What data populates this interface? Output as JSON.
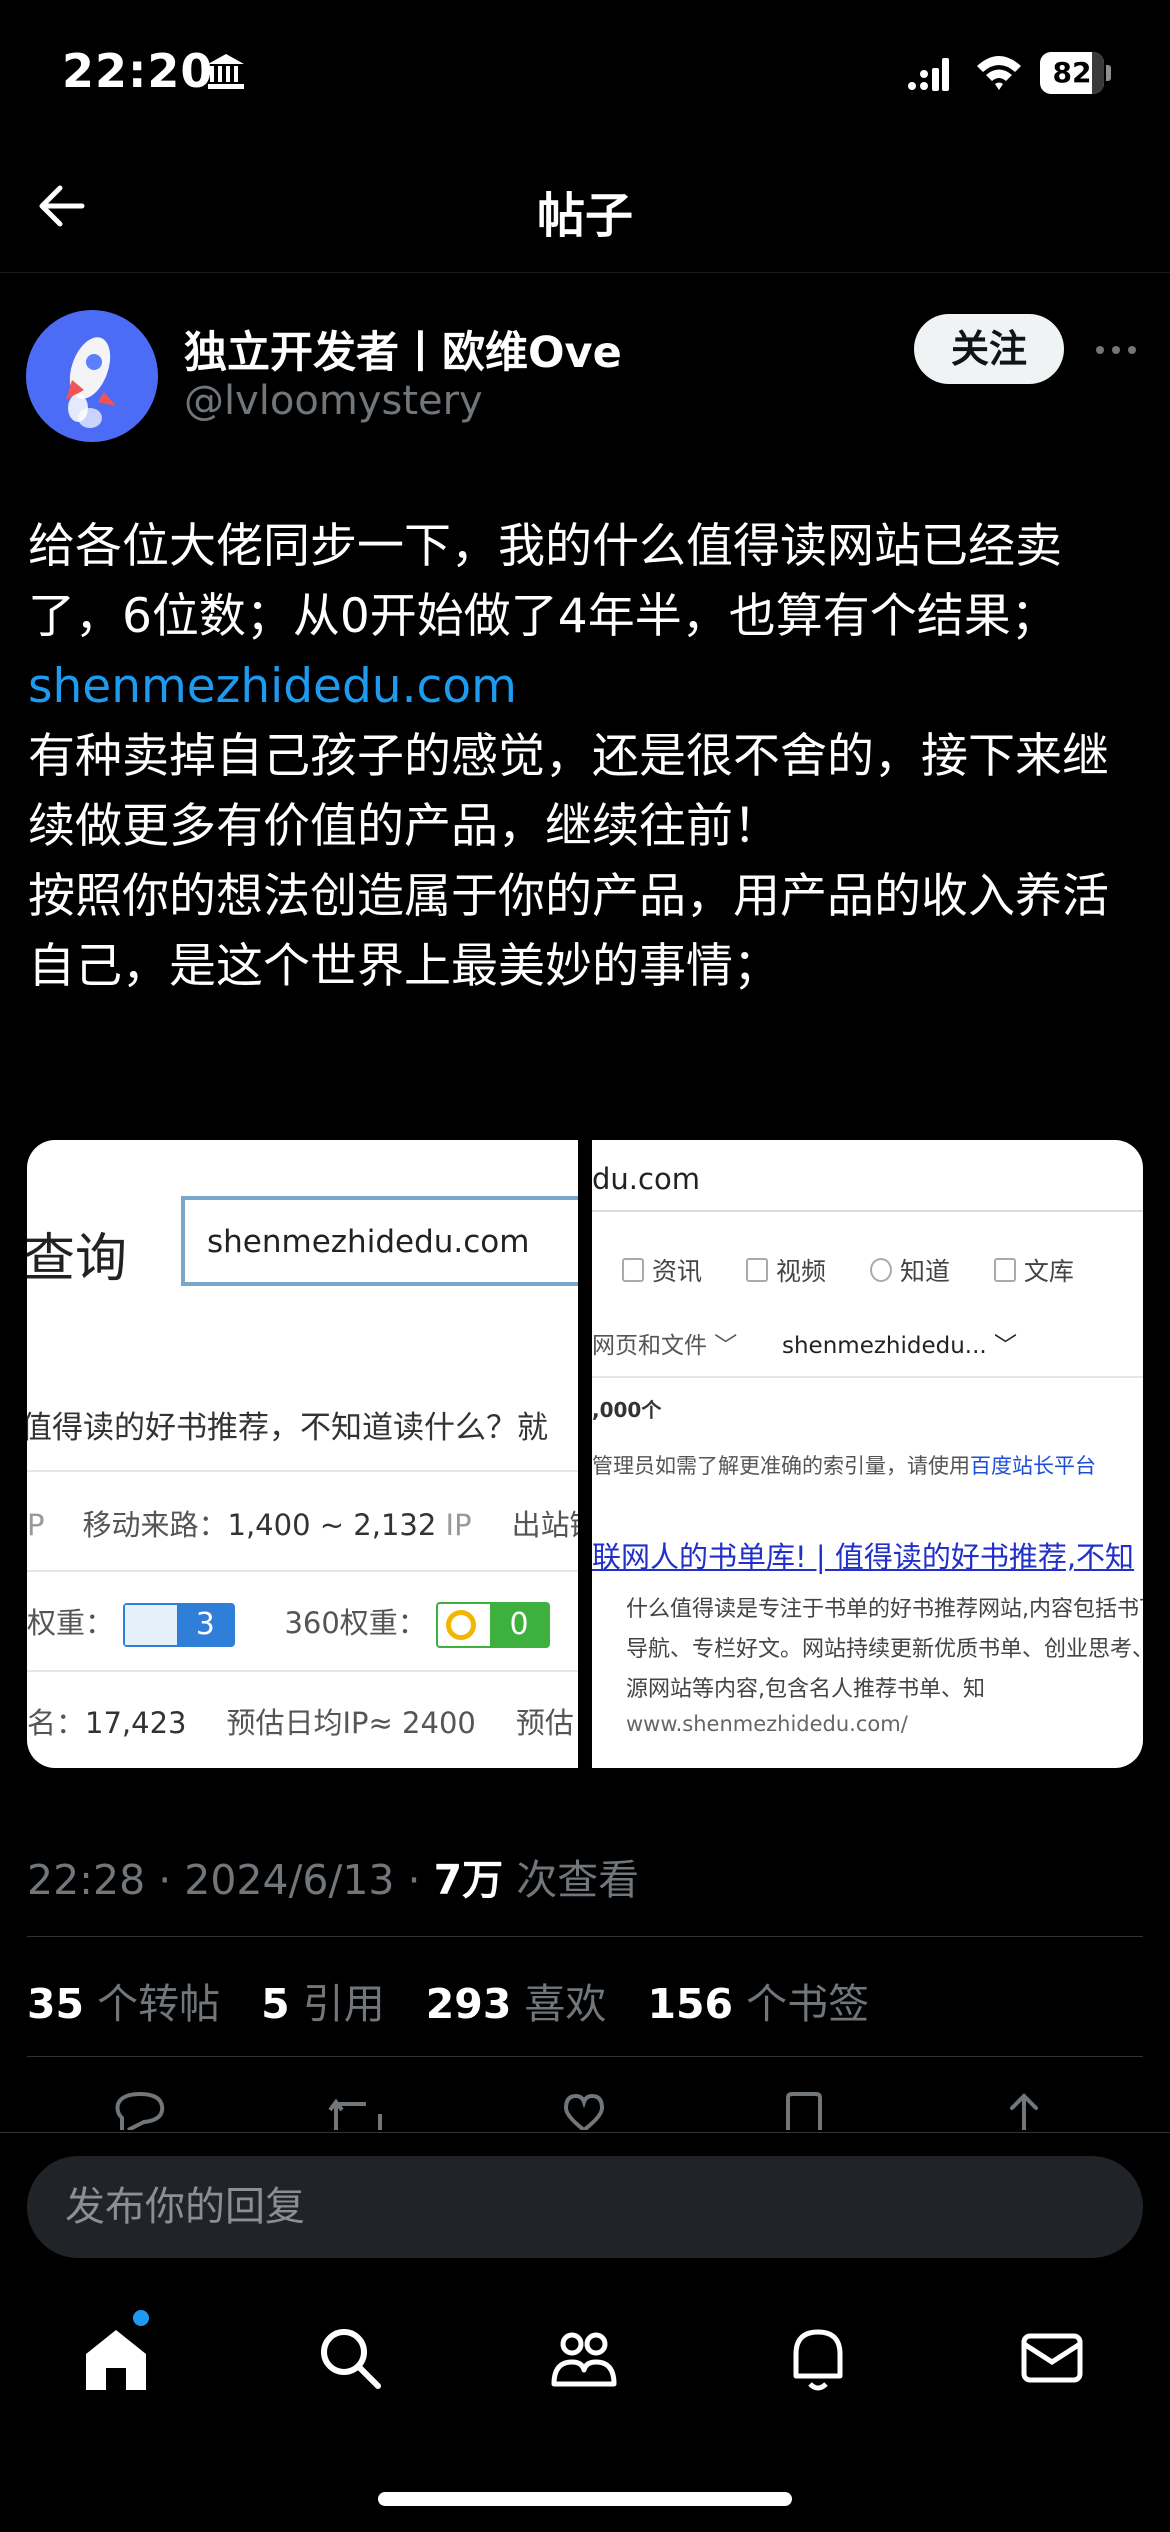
{
  "status_bar": {
    "time": "22:20",
    "battery": "82",
    "battery_level": 0.82,
    "icons": [
      "bank-icon",
      "signal-icon",
      "wifi-icon",
      "battery-icon"
    ]
  },
  "header": {
    "title": "帖子",
    "back_icon": "arrow-left-icon"
  },
  "author": {
    "display_name": "独立开发者丨欧维Ove",
    "handle": "@lvloomystery",
    "follow_label": "关注",
    "avatar_icon": "rocket-avatar-icon"
  },
  "post": {
    "lines": [
      "给各位大佬同步一下，我的什么值得读网站已经卖了，6位数；从0开始做了4年半，也算有个结果；",
      "shenmezhidedu.com",
      "有种卖掉自己孩子的感觉，还是很不舍的，接下来继续做更多有价值的产品，继续往前！",
      "按照你的想法创造属于你的产品，用产品的收入养活自己，是这个世界上最美妙的事情；"
    ],
    "link_color": "#1d9bf0"
  },
  "media": {
    "left": {
      "query_label": "查询",
      "input_value": "shenmezhidedu.com",
      "row1": "值得读的好书推荐，不知道读什么？就",
      "row2_a": "P",
      "row2_b": "移动来路：",
      "row2_c": "1,400 ~ 2,132",
      "row2_d": "IP",
      "row2_e": "出站链",
      "baidu_label": "权重：",
      "baidu_value": "3",
      "so_label": "360权重：",
      "so_value": "0",
      "row4_a": "名：",
      "row4_b": "17,423",
      "row4_c": "预估日均IP≈ 2400",
      "row4_d": "预估"
    },
    "right": {
      "url": "du.com",
      "tabs": [
        "资讯",
        "视频",
        "知道",
        "文库"
      ],
      "filter_type": "网页和文件",
      "filter_site": "shenmezhidedu...",
      "count": ",000个",
      "note_prefix": "管理员如需了解更准确的索引量，请使用",
      "note_link": "百度站长平台",
      "result_title": "联网人的书单库! | 值得读的好书推荐,不知",
      "result_desc": "什么值得读是专注于书单的好书推荐网站,内容包括书下载导航、专栏好文。网站持续更新优质书单、创业思考、资源网站等内容,包含名人推荐书单、知",
      "result_site": "www.shenmezhidedu.com/"
    }
  },
  "meta": {
    "time": "22:28",
    "date": "2024/6/13",
    "views_value": "7万",
    "views_label": "次查看"
  },
  "stats": {
    "reposts_value": "35",
    "reposts_label": "个转帖",
    "quotes_value": "5",
    "quotes_label": "引用",
    "likes_value": "293",
    "likes_label": "喜欢",
    "bookmarks_value": "156",
    "bookmarks_label": "个书签"
  },
  "reply": {
    "placeholder": "发布你的回复"
  },
  "tabbar": {
    "items": [
      "home-icon",
      "search-icon",
      "communities-icon",
      "notifications-icon",
      "messages-icon"
    ],
    "badge_color": "#1d9bf0"
  }
}
